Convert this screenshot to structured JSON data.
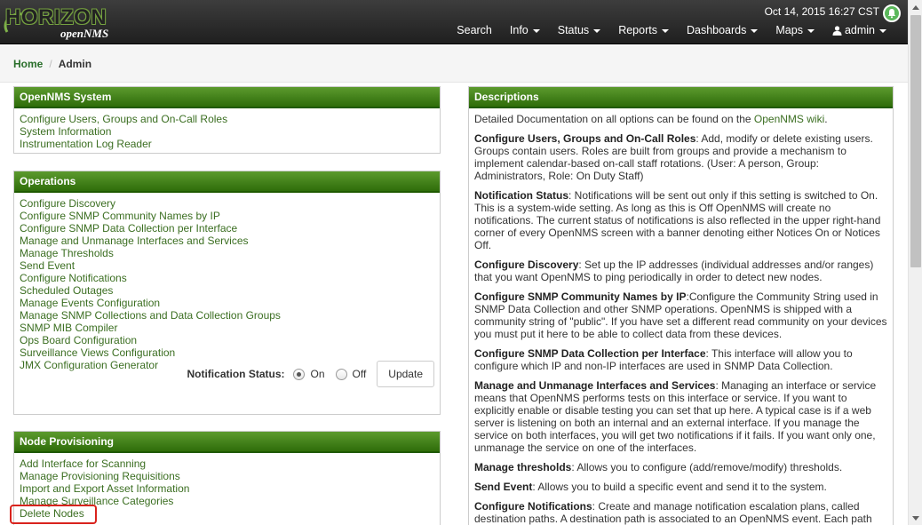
{
  "header": {
    "logo_main": "HORIZON",
    "logo_sub": "openNMS",
    "datetime": "Oct 14, 2015 16:27 CST",
    "nav": [
      {
        "label": "Search",
        "has_dropdown": false
      },
      {
        "label": "Info",
        "has_dropdown": true
      },
      {
        "label": "Status",
        "has_dropdown": true
      },
      {
        "label": "Reports",
        "has_dropdown": true
      },
      {
        "label": "Dashboards",
        "has_dropdown": true
      },
      {
        "label": "Maps",
        "has_dropdown": true
      },
      {
        "label": "admin",
        "has_dropdown": true,
        "icon": "user-icon"
      }
    ],
    "bell_color": "#5cb85c"
  },
  "breadcrumb": {
    "home": "Home",
    "separator": "/",
    "current": "Admin"
  },
  "opennms_system": {
    "title": "OpenNMS System",
    "links": [
      "Configure Users, Groups and On-Call Roles",
      "System Information",
      "Instrumentation Log Reader"
    ]
  },
  "operations": {
    "title": "Operations",
    "links": [
      "Configure Discovery",
      "Configure SNMP Community Names by IP",
      "Configure SNMP Data Collection per Interface",
      "Manage and Unmanage Interfaces and Services",
      "Manage Thresholds",
      "Send Event",
      "Configure Notifications",
      "Scheduled Outages",
      "Manage Events Configuration",
      "Manage SNMP Collections and Data Collection Groups",
      "SNMP MIB Compiler",
      "Ops Board Configuration",
      "Surveillance Views Configuration",
      "JMX Configuration Generator"
    ],
    "notification_status_label": "Notification Status:",
    "on_label": "On",
    "off_label": "Off",
    "selected": "On",
    "update_label": "Update"
  },
  "node_provisioning": {
    "title": "Node Provisioning",
    "links": [
      "Add Interface for Scanning",
      "Manage Provisioning Requisitions",
      "Import and Export Asset Information",
      "Manage Surveillance Categories",
      "Delete Nodes"
    ]
  },
  "descriptions": {
    "title": "Descriptions",
    "intro_prefix": "Detailed Documentation on all options can be found on the ",
    "intro_link": "OpenNMS wiki",
    "intro_suffix": ".",
    "items": [
      {
        "term": "Configure Users, Groups and On-Call Roles",
        "text": ": Add, modify or delete existing users. Groups contain users. Roles are built from groups and provide a mechanism to implement calendar-based on-call staff rotations. (User: A person, Group: Administrators, Role: On Duty Staff)"
      },
      {
        "term": "Notification Status",
        "text": ": Notifications will be sent out only if this setting is switched to On. This is a system-wide setting. As long as this is Off OpenNMS will create no notifications. The current status of notifications is also reflected in the upper right-hand corner of every OpenNMS screen with a banner denoting either Notices On or Notices Off."
      },
      {
        "term": "Configure Discovery",
        "text": ": Set up the IP addresses (individual addresses and/or ranges) that you want OpenNMS to ping periodically in order to detect new nodes."
      },
      {
        "term": "Configure SNMP Community Names by IP",
        "text": ":Configure the Community String used in SNMP Data Collection and other SNMP operations. OpenNMS is shipped with a community string of \"public\". If you have set a different read community on your devices you must put it here to be able to collect data from these devices."
      },
      {
        "term": "Configure SNMP Data Collection per Interface",
        "text": ": This interface will allow you to configure which IP and non-IP interfaces are used in SNMP Data Collection."
      },
      {
        "term": "Manage and Unmanage Interfaces and Services",
        "text": ": Managing an interface or service means that OpenNMS performs tests on this interface or service. If you want to explicitly enable or disable testing you can set that up here. A typical case is if a web server is listening on both an internal and an external interface. If you manage the service on both interfaces, you will get two notifications if it fails. If you want only one, unmanage the service on one of the interfaces."
      },
      {
        "term": "Manage thresholds",
        "text": ": Allows you to configure (add/remove/modify) thresholds."
      },
      {
        "term": "Send Event",
        "text": ": Allows you to build a specific event and send it to the system."
      },
      {
        "term": "Configure Notifications",
        "text": ": Create and manage notification escalation plans, called destination paths. A destination path is associated to an OpenNMS event. Each path"
      }
    ]
  },
  "colors": {
    "panel_header_top": "#5c9a2e",
    "panel_header_bottom": "#2f6d0a",
    "link": "#3b6e21",
    "highlight": "#d9231d"
  }
}
